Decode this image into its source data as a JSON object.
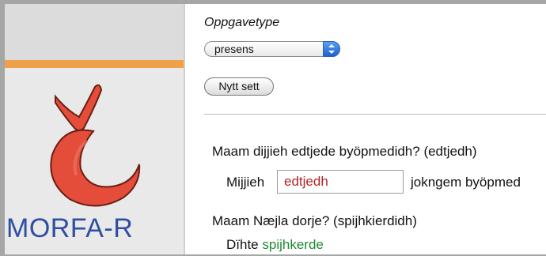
{
  "sidebar": {
    "brand": "MORFA-R",
    "logo_icon": "morfa-c-hacek-logo",
    "colors": {
      "accent_rule": "#f0a04a",
      "brand_text": "#2e4fa1",
      "logo_red": "#e34d3a"
    }
  },
  "main": {
    "task_type_label": "Oppgavetype",
    "task_type_select": {
      "selected": "presens"
    },
    "new_set_button": "Nytt sett",
    "questions": [
      {
        "question": "Maam dijjieh edtjede byöpmedidh? (edtjedh)",
        "subject": "Mijjieh",
        "answer_value": "edtjedh",
        "predicate": "jokngem byöpmed"
      },
      {
        "question": "Maam Næjla dorje? (spijhkierdidh)",
        "subject": "Dïhte",
        "answer_value": "spijhkerde"
      }
    ],
    "colors": {
      "wrong_answer": "#b02424",
      "correct_answer": "#1f8a32"
    }
  }
}
